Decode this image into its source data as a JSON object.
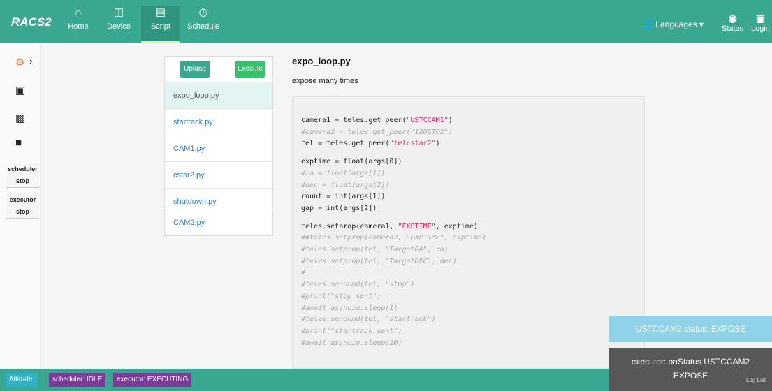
{
  "app": {
    "brand": "RACS2"
  },
  "nav": [
    {
      "label": "Home",
      "icon": "home-icon"
    },
    {
      "label": "Device",
      "icon": "device-icon"
    },
    {
      "label": "Script",
      "icon": "script-icon",
      "active": true
    },
    {
      "label": "Schedule",
      "icon": "clock-icon"
    }
  ],
  "header_right": {
    "languages": "Languages",
    "status": "Status",
    "login": "Login"
  },
  "sidebar": {
    "scheduler_label": "scheduler",
    "scheduler_state": "stop",
    "executor_label": "executor",
    "executor_state": "stop"
  },
  "script_list": {
    "upload_label": "Upload",
    "execute_label": "Execute",
    "items": [
      "expo_loop.py",
      "startrack.py",
      "CAM1.py",
      "cstar2.py",
      "shutdown.py",
      "CAM2.py"
    ],
    "selected": "expo_loop.py"
  },
  "script": {
    "title": "expo_loop.py",
    "description": "expose many times"
  },
  "toasts": {
    "status": "USTCCAM2 status: EXPOSE",
    "executor_line1": "executor: onStatus USTCCAM2",
    "executor_line2": "EXPOSE"
  },
  "bottom": {
    "altitude": "Altitude:",
    "scheduler": "scheduler: IDLE",
    "executor": "executor: EXECUTING",
    "log_list": "Log List"
  },
  "colors": {
    "primary": "#3aa890",
    "execute": "#37c16a",
    "badge_purple": "#7a3b9a",
    "badge_cyan": "#2fb2c5",
    "string": "#e0245e"
  }
}
